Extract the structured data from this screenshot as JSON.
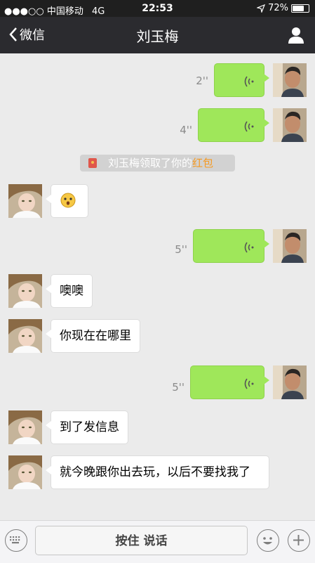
{
  "status": {
    "carrier": "●●●○○ 中国移动",
    "network": "4G",
    "time": "22:53",
    "battery": "72%",
    "battery_level": 0.72
  },
  "nav": {
    "back_label": "微信",
    "title": "刘玉梅"
  },
  "messages": [
    {
      "side": "right",
      "type": "voice",
      "duration": "2''"
    },
    {
      "side": "right",
      "type": "voice",
      "duration": "4''"
    },
    {
      "side": "center",
      "type": "notice",
      "text_pre": "刘玉梅领取了你的",
      "highlight": "红包"
    },
    {
      "side": "left",
      "type": "emoji"
    },
    {
      "side": "right",
      "type": "voice",
      "duration": "5''"
    },
    {
      "side": "left",
      "type": "text",
      "text": "噢噢"
    },
    {
      "side": "left",
      "type": "text",
      "text": "你现在在哪里"
    },
    {
      "side": "right",
      "type": "voice",
      "duration": "5''"
    },
    {
      "side": "left",
      "type": "text",
      "text": "到了发信息"
    },
    {
      "side": "left",
      "type": "text",
      "text": "就今晚跟你出去玩，以后不要找我了"
    }
  ],
  "input": {
    "hold_label": "按住 说话"
  },
  "colors": {
    "bubble_green": "#9fe75a",
    "nav_bg": "#2b2b2f",
    "chat_bg": "#ebebeb",
    "highlight": "#f59a23"
  }
}
